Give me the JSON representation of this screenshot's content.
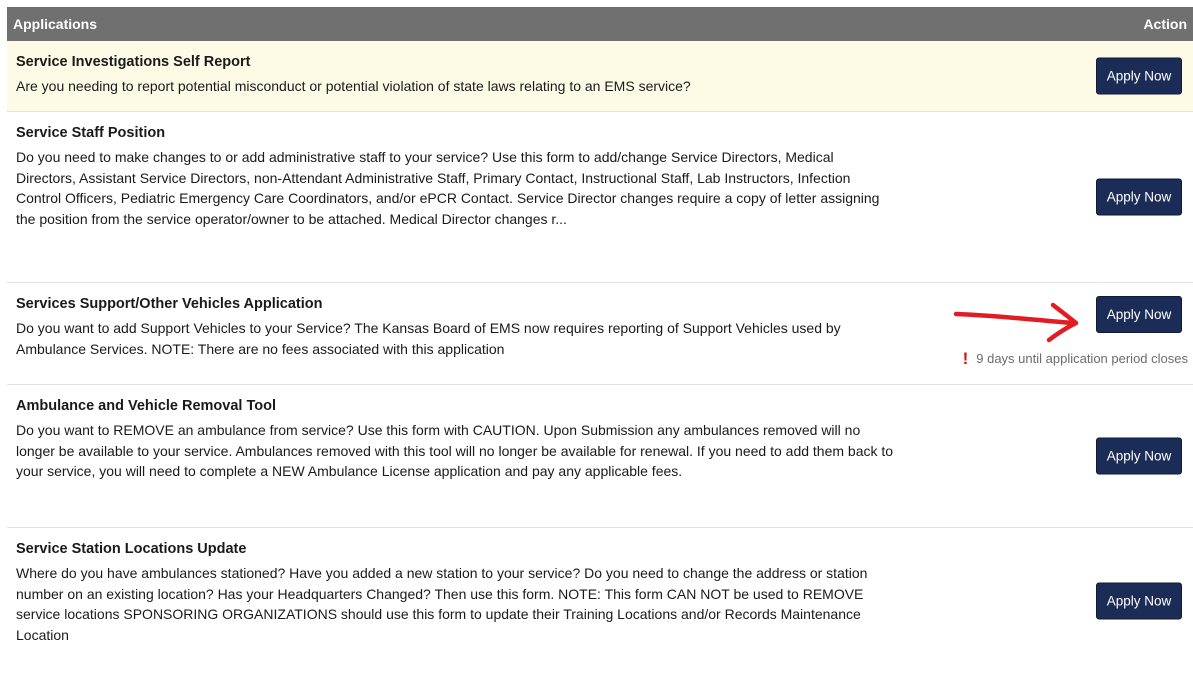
{
  "table": {
    "header_left": "Applications",
    "header_right": "Action"
  },
  "rows": [
    {
      "title": "Service Investigations Self Report",
      "description": "Are you needing to report potential misconduct or potential violation of state laws relating to an EMS service?",
      "button": "Apply Now"
    },
    {
      "title": "Service Staff Position",
      "description": "Do you need to make changes to or add administrative staff to your service? Use this form to add/change Service Directors, Medical Directors, Assistant Service Directors, non-Attendant Administrative Staff, Primary Contact, Instructional Staff, Lab Instructors, Infection Control Officers, Pediatric Emergency Care Coordinators, and/or ePCR Contact. Service Director changes require a copy of letter assigning the position from the service operator/owner to be attached. Medical Director changes r...",
      "button": "Apply Now"
    },
    {
      "title": "Services Support/Other Vehicles Application",
      "description": "Do you want to add Support Vehicles to your Service? The Kansas Board of EMS now requires reporting of Support Vehicles used by Ambulance Services. NOTE: There are no fees associated with this application",
      "button": "Apply Now",
      "notice": "9 days until application period closes",
      "notice_icon": "!"
    },
    {
      "title": "Ambulance and Vehicle Removal Tool",
      "description": "Do you want to REMOVE an ambulance from service? Use this form with CAUTION. Upon Submission any ambulances removed will no longer be available to your service. Ambulances removed with this tool will no longer be available for renewal. If you need to add them back to your service, you will need to complete a NEW Ambulance License application and pay any applicable fees.",
      "button": "Apply Now"
    },
    {
      "title": "Service Station Locations Update",
      "description": "Where do you have ambulances stationed? Have you added a new station to your service? Do you need to change the address or station number on an existing location? Has your Headquarters Changed? Then use this form. NOTE: This form CAN NOT be used to REMOVE service locations SPONSORING ORGANIZATIONS should use this form to update their Training Locations and/or Records Maintenance Location",
      "button": "Apply Now"
    }
  ],
  "colors": {
    "header_bg": "#707070",
    "highlight_row_bg": "#fdfbe6",
    "button_bg": "#1b2d57",
    "annotation_arrow": "#e31b23",
    "notice_icon": "#d0151a"
  }
}
